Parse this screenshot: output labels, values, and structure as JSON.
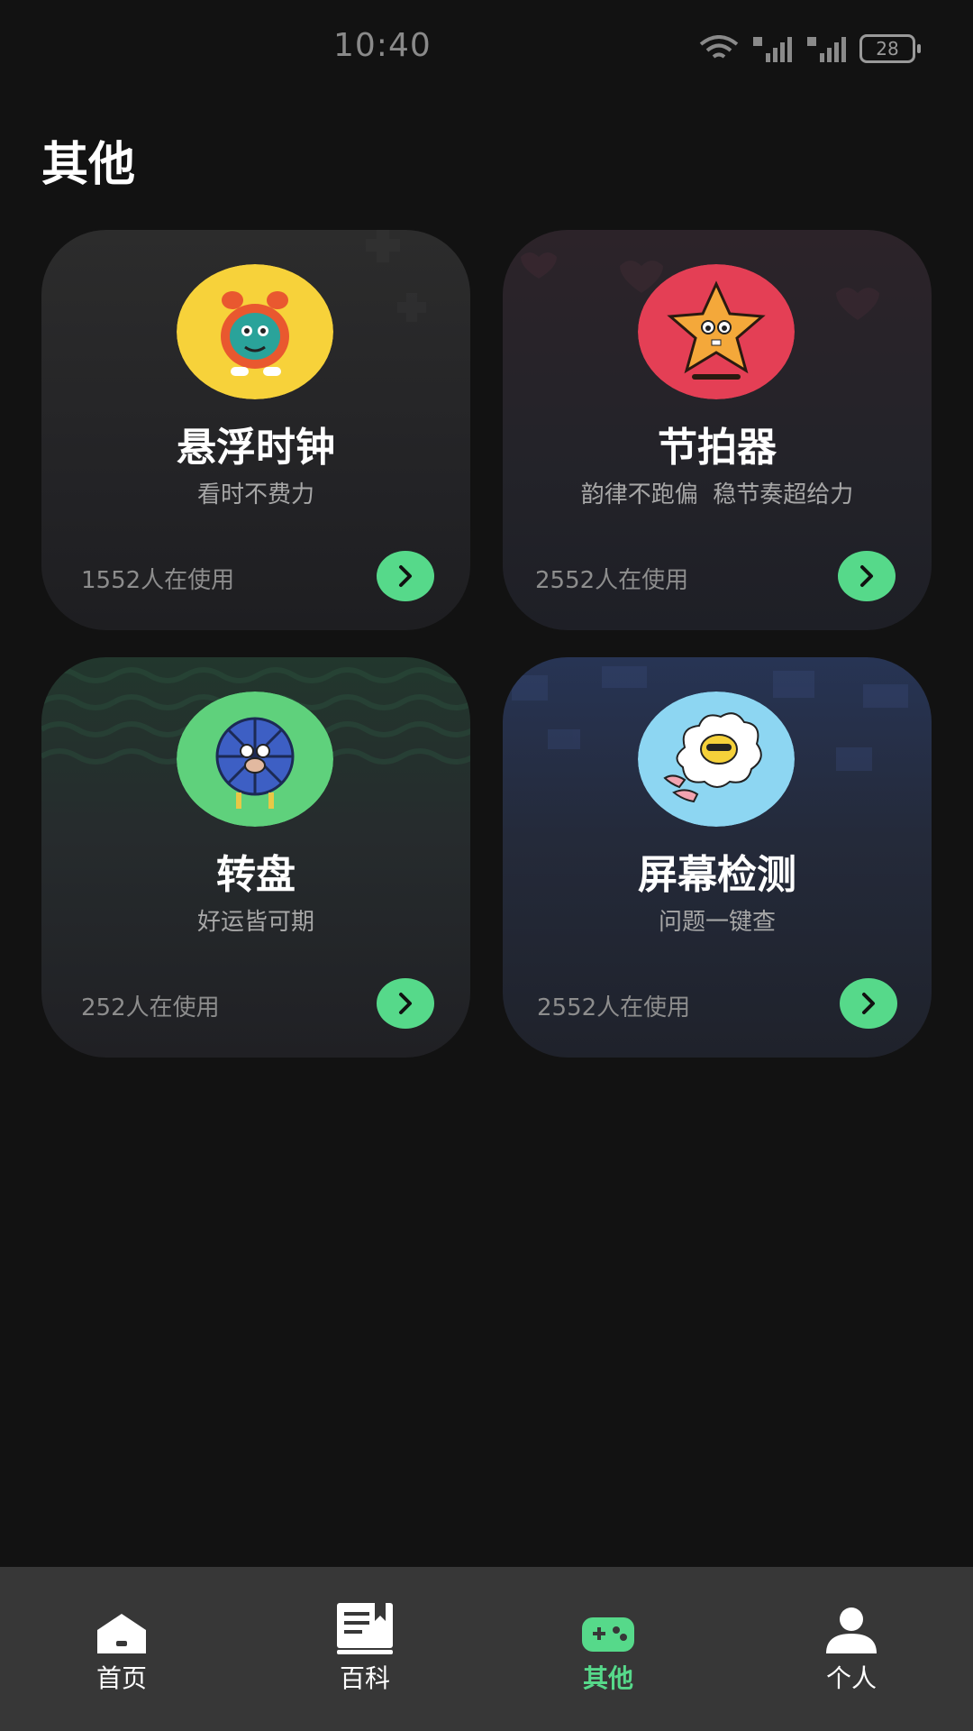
{
  "status_bar": {
    "time": "10:40",
    "battery": "28",
    "icons": [
      "wifi-icon",
      "signal-5g-icon",
      "signal-4g-icon",
      "battery-icon"
    ]
  },
  "page": {
    "title": "其他"
  },
  "cards": [
    {
      "title": "悬浮时钟",
      "subtitle": "看时不费力",
      "usage": "1552人在使用",
      "avatar_bg": "#f7d23a",
      "icon": "alarm-clock-character-icon"
    },
    {
      "title": "节拍器",
      "subtitle": "韵律不跑偏  稳节奏超给力",
      "usage": "2552人在使用",
      "avatar_bg": "#e43f55",
      "icon": "star-character-icon"
    },
    {
      "title": "转盘",
      "subtitle": "好运皆可期",
      "usage": "252人在使用",
      "avatar_bg": "#5fd17c",
      "icon": "spinner-character-icon"
    },
    {
      "title": "屏幕检测",
      "subtitle": "问题一键查",
      "usage": "2552人在使用",
      "avatar_bg": "#8dd6f2",
      "icon": "egg-character-icon"
    }
  ],
  "bottom_nav": {
    "active": 2,
    "items": [
      {
        "label": "首页",
        "icon": "home-icon"
      },
      {
        "label": "百科",
        "icon": "book-icon"
      },
      {
        "label": "其他",
        "icon": "gamepad-icon"
      },
      {
        "label": "个人",
        "icon": "person-icon"
      }
    ]
  },
  "colors": {
    "accent": "#56d98a",
    "background": "#121212",
    "nav_background": "#373737"
  }
}
